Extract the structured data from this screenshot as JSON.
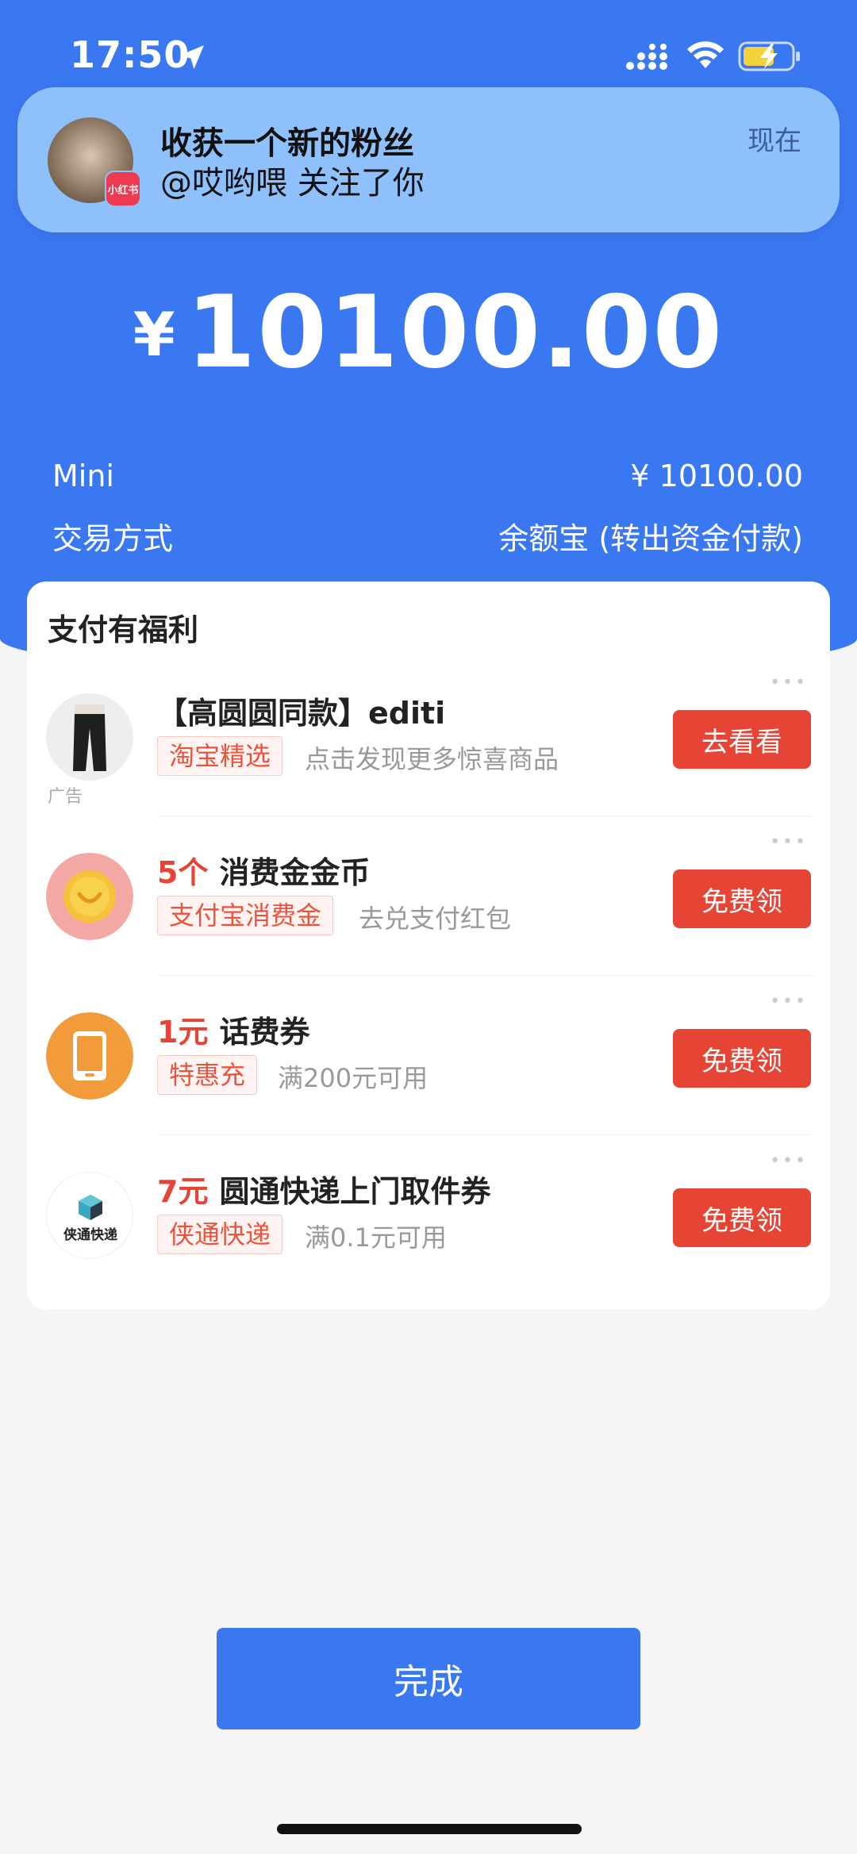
{
  "status_bar": {
    "time": "17:50"
  },
  "notification": {
    "app_badge": "小红书",
    "title": "收获一个新的粉丝",
    "body": "@哎哟喂 关注了你",
    "time": "现在"
  },
  "payment": {
    "currency": "¥",
    "amount": "10100.00",
    "payee_label": "Mini",
    "payee_amount": "¥ 10100.00",
    "method_label": "交易方式",
    "method_value": "余额宝 (转出资金付款)"
  },
  "benefits": {
    "title": "支付有福利",
    "items": [
      {
        "title_highlight": "",
        "title": "【高圆圆同款】editi",
        "tag": "淘宝精选",
        "sub": "点击发现更多惊喜商品",
        "button": "去看看",
        "ad_tag": "广告",
        "icon": "pants-icon"
      },
      {
        "title_highlight": "5个",
        "title": "消费金金币",
        "tag": "支付宝消费金",
        "sub": "去兑支付红包",
        "button": "免费领",
        "icon": "coin-icon"
      },
      {
        "title_highlight": "1元",
        "title": "话费券",
        "tag": "特惠充",
        "sub": "满200元可用",
        "button": "免费领",
        "icon": "phone-icon"
      },
      {
        "title_highlight": "7元",
        "title": "圆通快递上门取件券",
        "tag": "侠通快递",
        "sub": "满0.1元可用",
        "button": "免费领",
        "icon": "courier-logo-icon",
        "logo_text": "侠通快递"
      }
    ]
  },
  "done_button": "完成",
  "colors": {
    "primary": "#3a78f2",
    "accent_red": "#e64535",
    "notification_bg": "#8ec1fb"
  }
}
